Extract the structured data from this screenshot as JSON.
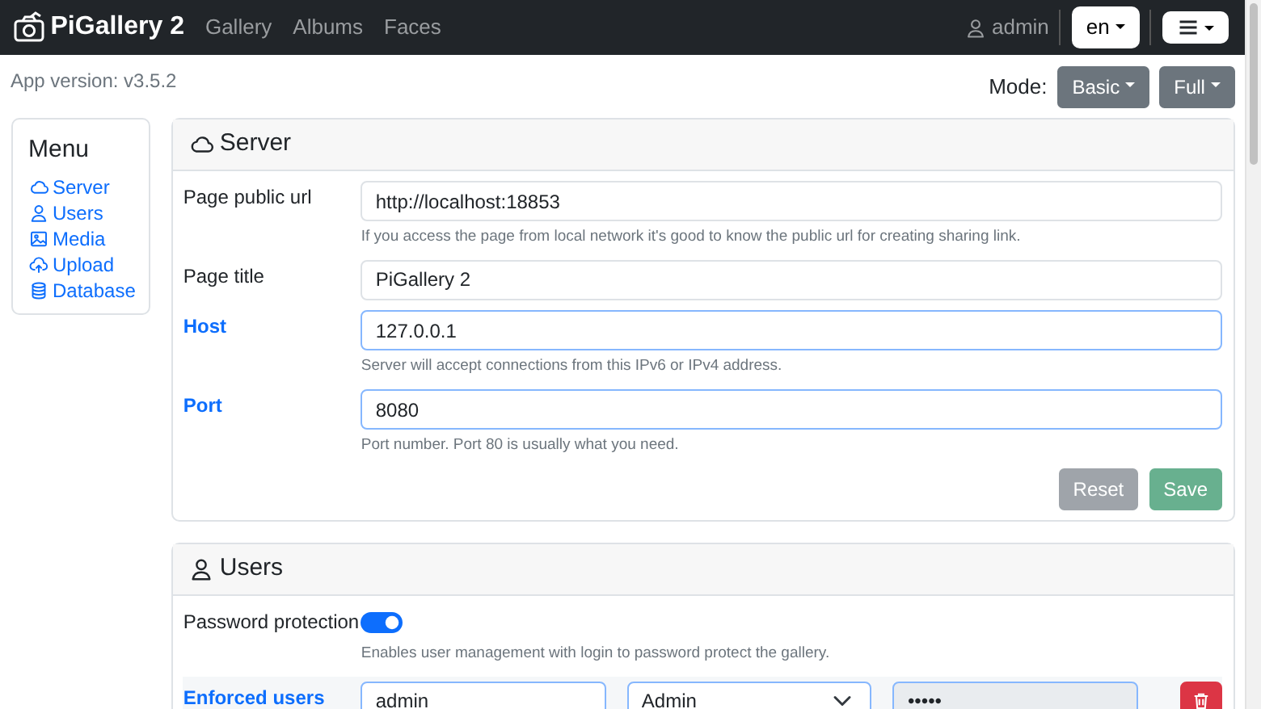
{
  "navbar": {
    "brand": "PiGallery 2",
    "links": [
      {
        "label": "Gallery"
      },
      {
        "label": "Albums"
      },
      {
        "label": "Faces"
      }
    ],
    "user": "admin",
    "language": "en"
  },
  "app_version": "App version: v3.5.2",
  "mode": {
    "label": "Mode:",
    "buttons": [
      "Basic",
      "Full"
    ]
  },
  "menu": {
    "title": "Menu",
    "items": [
      {
        "label": "Server"
      },
      {
        "label": "Users"
      },
      {
        "label": "Media"
      },
      {
        "label": "Upload"
      },
      {
        "label": "Database"
      }
    ]
  },
  "sections": [
    {
      "title": "Server",
      "fields": [
        {
          "kind": "text",
          "label": "Page public url",
          "value": "http://localhost:18853",
          "changed": false,
          "help": "If you access the page from local network it's good to know the public url for creating sharing link."
        },
        {
          "kind": "text",
          "label": "Page title",
          "value": "PiGallery 2",
          "changed": false
        },
        {
          "kind": "text",
          "label": "Host",
          "value": "127.0.0.1",
          "changed": true,
          "help": "Server will accept connections from this IPv6 or IPv4 address."
        },
        {
          "kind": "text",
          "label": "Port",
          "value": "8080",
          "changed": true,
          "help": "Port number. Port 80 is usually what you need."
        }
      ],
      "buttons": [
        {
          "label": "Reset",
          "kind": "reset",
          "disabled": true
        },
        {
          "label": "Save",
          "kind": "save",
          "disabled": true
        }
      ]
    },
    {
      "title": "Users",
      "fields": [
        {
          "kind": "toggle",
          "label": "Password protection",
          "on": true,
          "changed": false,
          "help": "Enables user management with login to password protect the gallery."
        },
        {
          "kind": "users",
          "label": "Enforced users",
          "changed": true,
          "users": [
            {
              "name": "admin",
              "role": "Admin",
              "password": "•••••"
            }
          ]
        }
      ]
    }
  ]
}
